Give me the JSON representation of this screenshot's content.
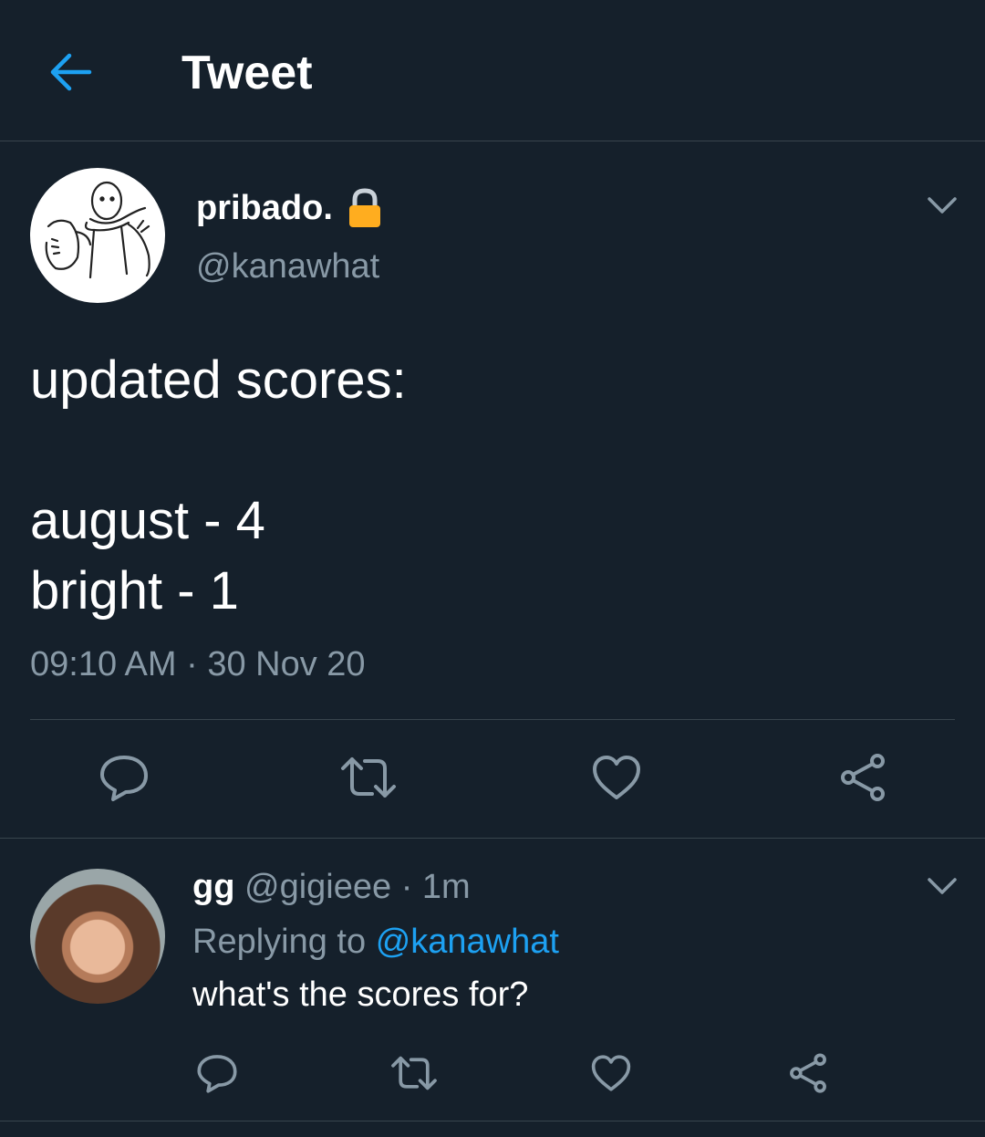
{
  "header": {
    "title": "Tweet",
    "back_icon": "arrow-left-icon"
  },
  "tweet": {
    "display_name": "pribado.",
    "protected_icon": "lock-icon",
    "handle": "@kanawhat",
    "text": "updated scores:\n\naugust - 4\nbright - 1",
    "time": "09:10 AM",
    "separator": "·",
    "date": "30 Nov 20",
    "actions": [
      "reply-icon",
      "retweet-icon",
      "like-icon",
      "share-icon"
    ]
  },
  "reply": {
    "display_name": "gg",
    "handle": "@gigieee",
    "separator": "·",
    "age": "1m",
    "replying_prefix": "Replying to",
    "replying_to": "@kanawhat",
    "text": "what's the scores for?",
    "actions": [
      "reply-icon",
      "retweet-icon",
      "like-icon",
      "share-icon"
    ]
  },
  "colors": {
    "background": "#15202b",
    "accent": "#1da1f2",
    "secondary_text": "#8899a6",
    "divider": "#38444d",
    "lock": "#ffad1f"
  }
}
